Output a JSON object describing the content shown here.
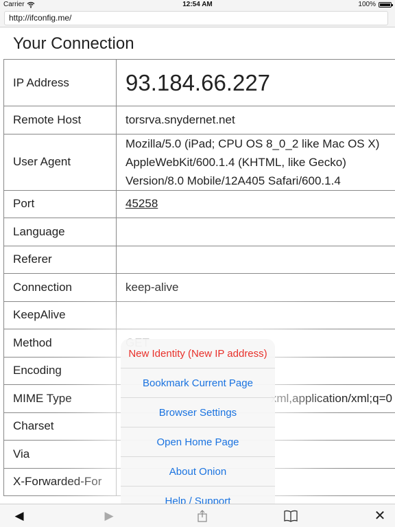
{
  "status_bar": {
    "carrier": "Carrier",
    "wifi_icon": "wifi-icon",
    "time": "12:54 AM",
    "battery": "100%"
  },
  "browser": {
    "url": "http://ifconfig.me/"
  },
  "page": {
    "heading": "Your Connection",
    "rows": [
      {
        "key": "IP Address",
        "value": "93.184.66.227"
      },
      {
        "key": "Remote Host",
        "value": "torsrva.snydernet.net"
      },
      {
        "key": "User Agent",
        "value_lines": [
          "Mozilla/5.0 (iPad; CPU OS 8_0_2 like Mac OS X)",
          "AppleWebKit/600.1.4 (KHTML, like Gecko)",
          "Version/8.0 Mobile/12A405 Safari/600.1.4"
        ]
      },
      {
        "key": "Port",
        "value": "45258"
      },
      {
        "key": "Language",
        "value": ""
      },
      {
        "key": "Referer",
        "value": ""
      },
      {
        "key": "Connection",
        "value": "keep-alive"
      },
      {
        "key": "KeepAlive",
        "value": ""
      },
      {
        "key": "Method",
        "value": "GET"
      },
      {
        "key": "Encoding",
        "value": ""
      },
      {
        "key": "MIME Type",
        "value": "xml,application/xml;q=0"
      },
      {
        "key": "Charset",
        "value": ""
      },
      {
        "key": "Via",
        "value": ""
      },
      {
        "key": "X-Forwarded-For",
        "value": ""
      }
    ]
  },
  "menu": {
    "items": [
      "New Identity (New IP address)",
      "Bookmark Current Page",
      "Browser Settings",
      "Open Home Page",
      "About Onion",
      "Help / Support"
    ]
  },
  "toolbar": {
    "back_icon": "back-arrow-icon",
    "forward_icon": "forward-arrow-icon",
    "share_icon": "share-icon",
    "bookmarks_icon": "bookmarks-icon",
    "close_icon": "close-icon"
  },
  "colors": {
    "menu_action": "#1a73e0",
    "menu_destructive": "#e8302a",
    "table_border": "#888888"
  }
}
